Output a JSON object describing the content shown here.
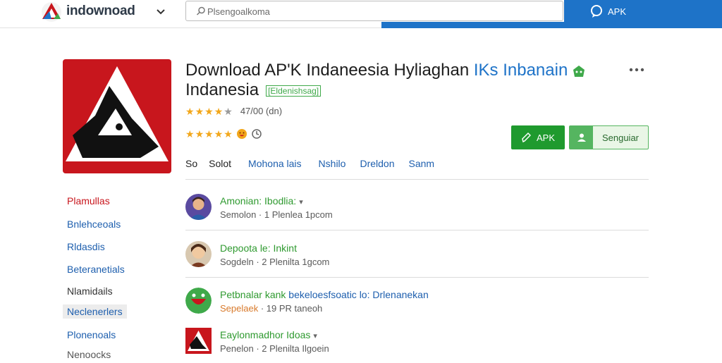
{
  "header": {
    "logo_text": "indownoad",
    "search_placeholder": "Plsengoalkoma",
    "apk_link": "APK"
  },
  "app": {
    "title_main": "Download AP'K Indaneesia Hyliaghan ",
    "title_highlight": "IKs Inbanain",
    "title_line2": "Indanesia",
    "dev_tag": "[Eldenishsag]",
    "rating_text": "47/00 (dn)",
    "stars_row1": 4,
    "stars_row2": 5,
    "buttons": {
      "apk": "APK",
      "sign_in": "Senguiar"
    },
    "tabs": [
      "So",
      "Solot",
      "Mohona lais",
      "Nshilo",
      "Dreldon",
      "Sanm"
    ]
  },
  "sidebar": {
    "items": [
      "Plamullas",
      "Bnlehceoals",
      "Rldasdis",
      "Beteranetials",
      "Nlamidails",
      "Neclenerlers",
      "Plonenoals",
      "Nenoocks"
    ]
  },
  "list": {
    "items": [
      {
        "title": "Amonian: Ibodlia:",
        "meta_a": "Semolon",
        "meta_b": "1 Plenlea 1pcom"
      },
      {
        "title": "Depoota le: Inkint",
        "meta_a": "Sogdeln",
        "meta_b": "2 Plenilta 1gcom"
      },
      {
        "title": "Petbnalar kank",
        "title_blue": "bekeloesfsoatic lo: Drlenanekan",
        "meta_a": "Sepelaek",
        "meta_b": "19 PR taneoh"
      },
      {
        "title": "Eaylonmadhor Idoas",
        "meta_a": "Penelon",
        "meta_b": "2 Plenilta Ilgoein"
      }
    ]
  },
  "colors": {
    "brand_blue": "#1e73c8",
    "link_blue": "#1e5fae",
    "green": "#1f9a2e",
    "red": "#c8161d",
    "star": "#f2a71b"
  }
}
